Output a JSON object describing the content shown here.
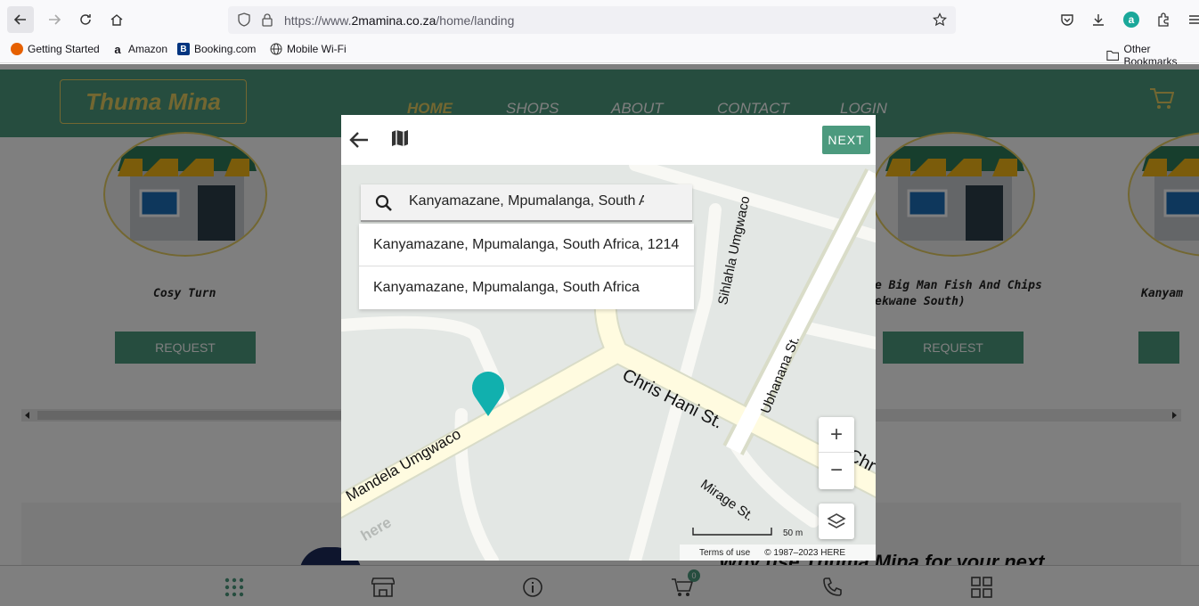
{
  "browser": {
    "url_prefix": "https://www.",
    "url_domain": "2mamina.co.za",
    "url_path": "/home/landing",
    "bookmarks": [
      "Getting Started",
      "Amazon",
      "Booking.com",
      "Mobile Wi-Fi"
    ],
    "other_bookmarks": "Other Bookmarks"
  },
  "site": {
    "logo": "Thuma Mina",
    "nav": [
      "HOME",
      "SHOPS",
      "ABOUT",
      "CONTACT",
      "LOGIN"
    ],
    "shops": [
      {
        "name": "Cosy Turn",
        "button": "REQUEST"
      },
      {
        "name_line1": "e Big Man Fish And Chips",
        "name_line2": "ekwane South)",
        "button": "REQUEST"
      },
      {
        "name": "Kanyam"
      }
    ],
    "why_text": "Why use Thuma Mina for your next",
    "cart_badge": "0"
  },
  "modal": {
    "next_label": "NEXT",
    "search_value": "Kanyamazane, Mpumalanga, South Africa",
    "suggestions": [
      "Kanyamazane, Mpumalanga, South Africa, 1214",
      "Kanyamazane, Mpumalanga, South Africa"
    ],
    "streets": {
      "chris_hani": "Chris Hani St.",
      "mandela": "Mandela Umgwaco",
      "sihlahla": "Sihlahla Umgwaco",
      "ubhanana": "Ubhanana St.",
      "mirage": "Mirage St.",
      "chr": "Chr"
    },
    "zoom_in": "+",
    "zoom_out": "−",
    "scale": "50 m",
    "terms": "Terms of use",
    "copyright": "© 1987–2023 HERE",
    "here_logo": "here"
  }
}
